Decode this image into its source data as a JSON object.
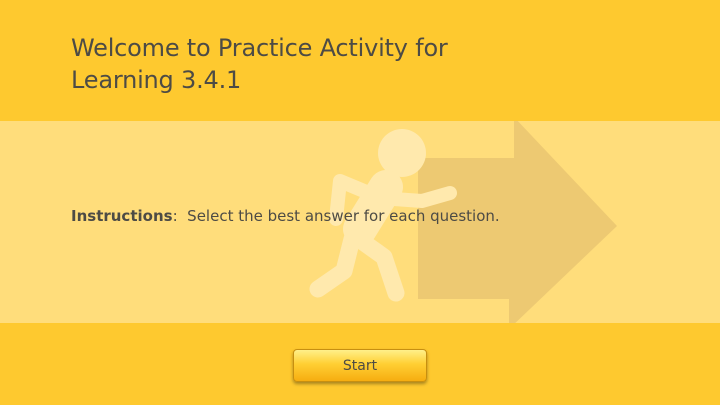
{
  "slide": {
    "title_line1": "Welcome to Practice Activity for",
    "title_line2": "Learning 3.4.1",
    "instructions_label": "Instructions",
    "instructions_sep": ":",
    "instructions_text": "Select the best answer for each question.",
    "start_label": "Start",
    "illustration": "running-person-arrow-icon"
  },
  "colors": {
    "background": "#fec92f",
    "band": "#ffdd7b",
    "text": "#4d4b45",
    "button_top": "#fff08a",
    "button_bottom": "#f6ad10"
  }
}
